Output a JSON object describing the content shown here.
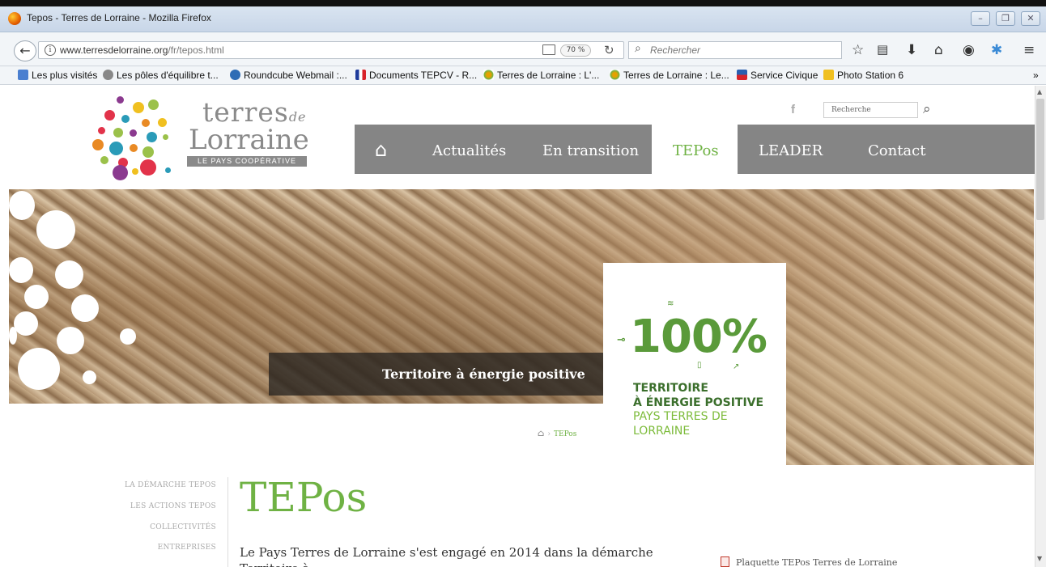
{
  "browser": {
    "window_title": "Tepos - Terres de Lorraine - Mozilla Firefox",
    "url_domain": "www.terresdelorraine.org",
    "url_path": "/fr/tepos.html",
    "zoom": "70 %",
    "search_placeholder": "Rechercher",
    "bookmarks": [
      "Les plus visités",
      "Les pôles d'équilibre t...",
      "Roundcube Webmail :...",
      "Documents TEPCV - R...",
      "Terres de Lorraine : L'...",
      "Terres de Lorraine : Le...",
      "Service Civique",
      "Photo Station 6"
    ],
    "more_bookmarks": "»"
  },
  "site": {
    "logo_terres": "terres",
    "logo_de": "de",
    "logo_lorraine": "Lorraine",
    "logo_tagline": "LE PAYS COOPÉRATIVE",
    "search_placeholder": "Recherche",
    "menu": [
      "Actualités",
      "En transition",
      "TEPos",
      "LEADER",
      "Contact"
    ],
    "active_menu": "TEPos",
    "colors": {
      "accent": "#6fb244",
      "menu_bg": "#858585"
    }
  },
  "hero": {
    "caption": "Territoire à énergie positive",
    "badge": {
      "percent": "100%",
      "line1": "TERRITOIRE",
      "line2": "À ÉNERGIE POSITIVE",
      "line3": "PAYS TERRES DE",
      "line4": "LORRAINE"
    }
  },
  "breadcrumb": {
    "current": "TEPos"
  },
  "sidebar": {
    "items": [
      "LA DÉMARCHE TEPOS",
      "LES ACTIONS TEPOS",
      "COLLECTIVITÉS",
      "ENTREPRISES"
    ]
  },
  "content": {
    "title": "TEPos",
    "intro": "Le Pays Terres de Lorraine s'est engagé en 2014 dans la démarche Territoire à",
    "download": "Plaquette TEPos Terres de Lorraine"
  }
}
